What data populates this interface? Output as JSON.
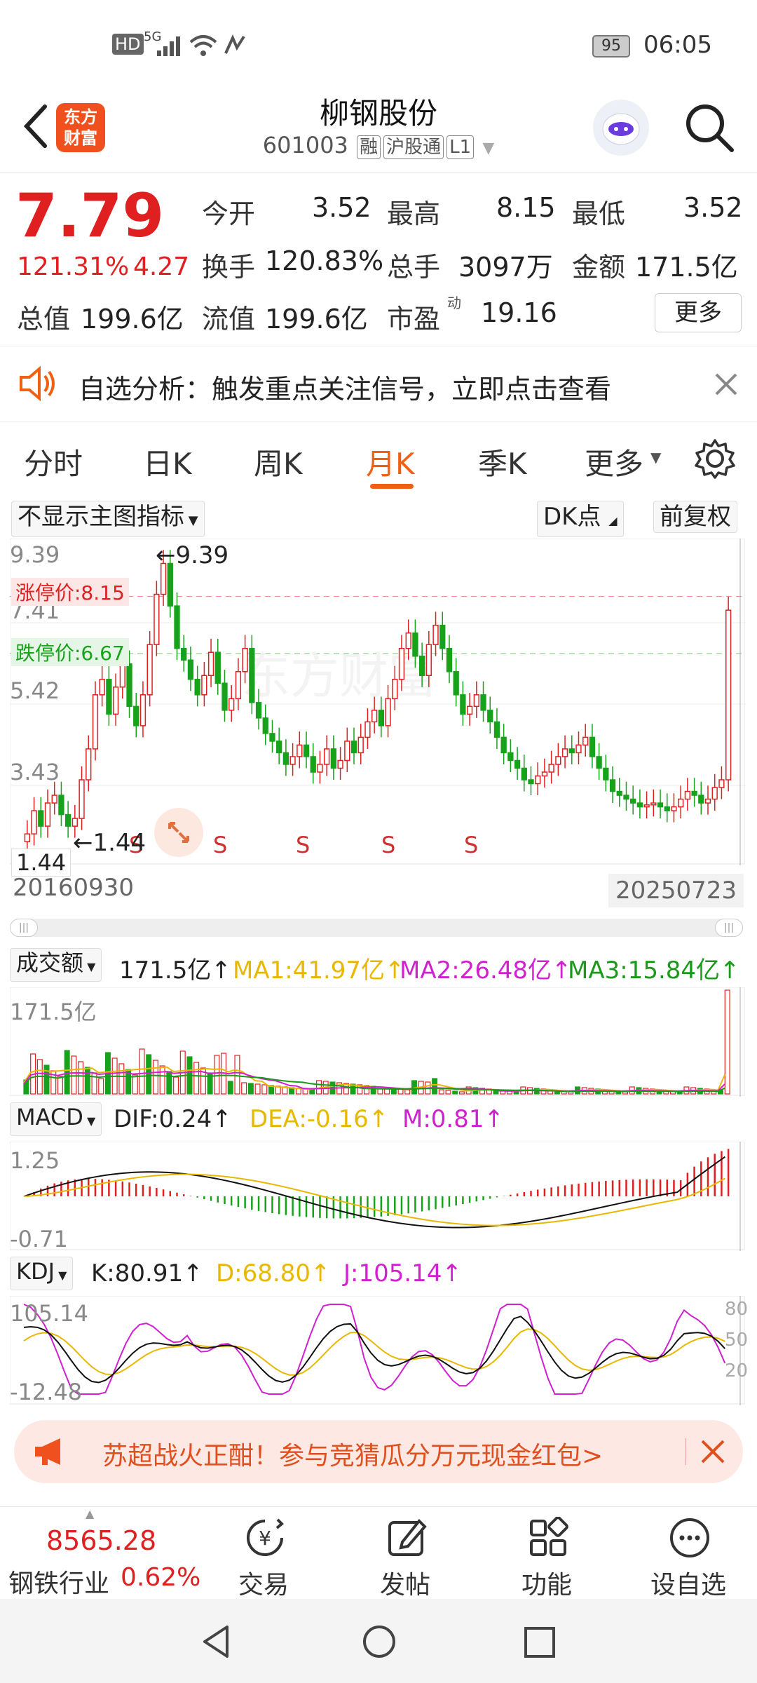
{
  "status_bar": {
    "time": "06:05",
    "battery": "95",
    "signal_label": "5G",
    "hd_label": "HD"
  },
  "header": {
    "logo_text": "东方\n财富",
    "title": "柳钢股份",
    "code": "601003",
    "tags": [
      "融",
      "沪股通",
      "L1"
    ]
  },
  "quote": {
    "price": "7.79",
    "change_pct": "121.31%",
    "change_amt": "4.27",
    "open_label": "今开",
    "open": "3.52",
    "high_label": "最高",
    "high": "8.15",
    "low_label": "最低",
    "low": "3.52",
    "turnover_label": "换手",
    "turnover": "120.83%",
    "volume_label": "总手",
    "volume": "3097万",
    "amount_label": "金额",
    "amount": "171.5亿",
    "total_mv_label": "总值",
    "total_mv": "199.6亿",
    "float_mv_label": "流值",
    "float_mv": "199.6亿",
    "pe_label": "市盈",
    "pe_sup": "动",
    "pe": "19.16",
    "more_label": "更多"
  },
  "notice": {
    "text": "自选分析：触发重点关注信号，立即点击查看"
  },
  "tabs": [
    {
      "label": "分时",
      "active": false
    },
    {
      "label": "日K",
      "active": false
    },
    {
      "label": "周K",
      "active": false
    },
    {
      "label": "月K",
      "active": true
    },
    {
      "label": "季K",
      "active": false
    },
    {
      "label": "更多",
      "active": false
    }
  ],
  "chart_controls": {
    "main_indicator": "不显示主图指标",
    "dk_label": "DK点",
    "adjust_label": "前复权"
  },
  "main_chart": {
    "y_labels": [
      "9.39",
      "7.41",
      "5.42",
      "3.43",
      "1.44"
    ],
    "limit_up_label": "涨停价:8.15",
    "limit_down_label": "跌停价:6.67",
    "max_marker": "←9.39",
    "min_marker": "←1.44",
    "min_value_box": "1.44",
    "start_date": "20160930",
    "end_date": "20250723",
    "s_marker": "S",
    "watermark": "东方财富"
  },
  "volume_panel": {
    "name": "成交额",
    "value": "171.5亿↑",
    "ma1": "MA1:41.97亿↑",
    "ma2": "MA2:26.48亿↑",
    "ma3": "MA3:15.84亿↑",
    "max_label": "171.5亿"
  },
  "macd_panel": {
    "name": "MACD",
    "dif": "DIF:0.24↑",
    "dea": "DEA:-0.16↑",
    "m": "M:0.81↑",
    "top_label": "1.25",
    "bottom_label": "-0.71"
  },
  "kdj_panel": {
    "name": "KDJ",
    "k": "K:80.91↑",
    "d": "D:68.80↑",
    "j": "J:105.14↑",
    "top_label": "105.14",
    "bottom_label": "-12.48",
    "right_labels": [
      "80",
      "50",
      "20"
    ]
  },
  "banner": {
    "text": "苏超战火正酣！参与竞猜瓜分万元现金红包>"
  },
  "bottom_bar": {
    "index_value": "8565.28",
    "index_name": "钢铁行业",
    "index_change": "0.62%",
    "items": [
      {
        "label": "交易",
        "icon": "trade-yen-icon"
      },
      {
        "label": "发帖",
        "icon": "edit-icon"
      },
      {
        "label": "功能",
        "icon": "grid-icon"
      },
      {
        "label": "设自选",
        "icon": "more-dots-icon"
      }
    ]
  },
  "colors": {
    "up": "#e02020",
    "down": "#17a21b",
    "accent": "#f06014",
    "ma1": "#e8b800",
    "ma2": "#d020d0",
    "ma3": "#1a9a1a"
  }
}
